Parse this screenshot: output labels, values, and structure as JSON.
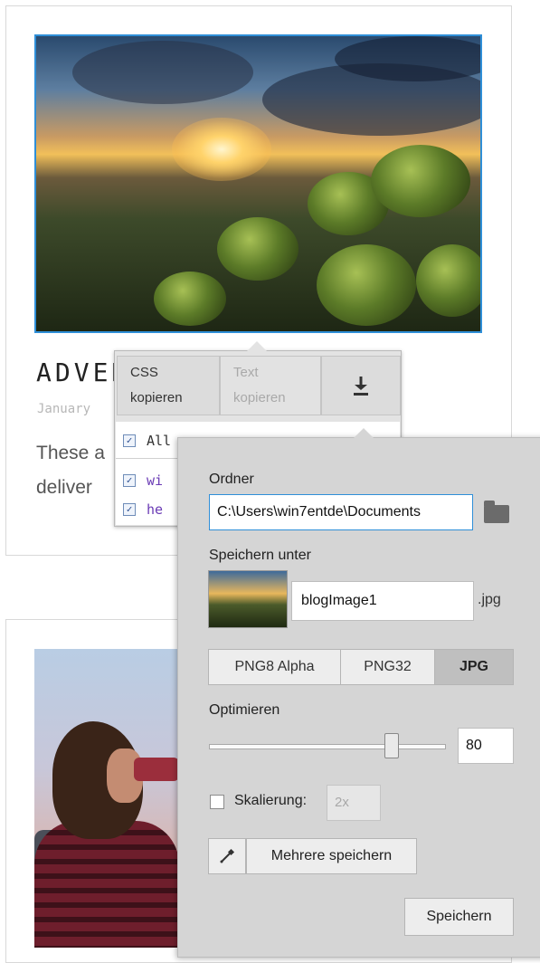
{
  "post": {
    "title": "ADVEN",
    "date": "January",
    "excerpt": "These a deliver"
  },
  "copy_popover": {
    "css_line1": "CSS",
    "css_line2": "kopieren",
    "text_line1": "Text",
    "text_line2": "kopieren",
    "download_icon": "download-icon",
    "select_all_label": "All",
    "items": [
      {
        "label": "wi",
        "checked": true
      },
      {
        "label": "he",
        "checked": true
      }
    ],
    "select_all_checked": true
  },
  "export_panel": {
    "folder_label": "Ordner",
    "folder_path": "C:\\Users\\win7entde\\Documents",
    "folder_icon": "folder-icon",
    "save_as_label": "Speichern unter",
    "filename": "blogImage1",
    "extension": ".jpg",
    "formats": [
      {
        "label": "PNG8 Alpha",
        "selected": false
      },
      {
        "label": "PNG32",
        "selected": false
      },
      {
        "label": "JPG",
        "selected": true
      }
    ],
    "optimize_label": "Optimieren",
    "quality": "80",
    "quality_value": 80,
    "scale_label": "Skalierung:",
    "scale_value": "2x",
    "scale_checked": false,
    "multi_save_label": "Mehrere speichern",
    "save_label": "Speichern"
  },
  "colors": {
    "accent": "#2f8fd8",
    "panel_bg": "#d5d5d5"
  }
}
